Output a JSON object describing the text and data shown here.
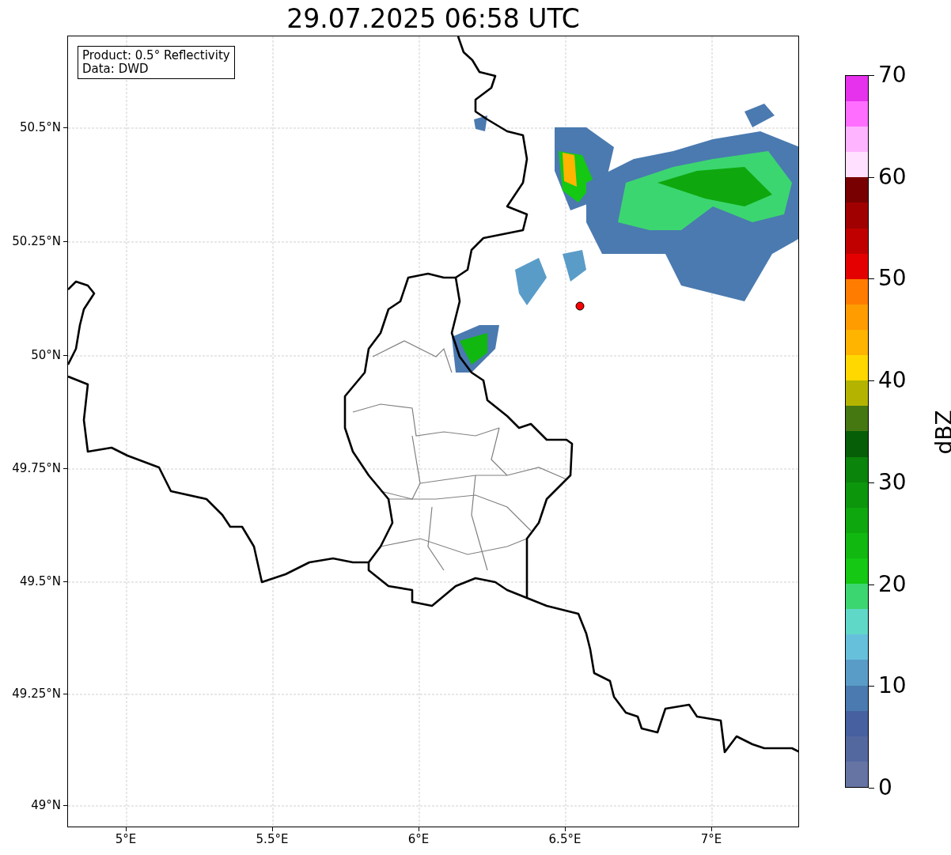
{
  "title": "29.07.2025 06:58 UTC",
  "info_box": {
    "lines": [
      "Product: 0.5° Reflectivity",
      "Data: DWD"
    ]
  },
  "map": {
    "x_ticks": [
      {
        "label": "5°E"
      },
      {
        "label": "5.5°E"
      },
      {
        "label": "6°E"
      },
      {
        "label": "6.5°E"
      },
      {
        "label": "7°E"
      }
    ],
    "y_ticks": [
      {
        "label": "50.5°N"
      },
      {
        "label": "50.25°N"
      },
      {
        "label": "50°N"
      },
      {
        "label": "49.75°N"
      },
      {
        "label": "49.5°N"
      },
      {
        "label": "49.25°N"
      },
      {
        "label": "49°N"
      }
    ]
  },
  "colorbar": {
    "label": "dBZ",
    "ticks": [
      {
        "label": "70"
      },
      {
        "label": "60"
      },
      {
        "label": "50"
      },
      {
        "label": "40"
      },
      {
        "label": "30"
      },
      {
        "label": "20"
      },
      {
        "label": "10"
      },
      {
        "label": "0"
      }
    ],
    "bands": [
      {
        "color": "#6674a4"
      },
      {
        "color": "#5468a0"
      },
      {
        "color": "#4660a0"
      },
      {
        "color": "#4a7ab0"
      },
      {
        "color": "#5a9cc8"
      },
      {
        "color": "#66c0dc"
      },
      {
        "color": "#60d8c8"
      },
      {
        "color": "#3cd670"
      },
      {
        "color": "#14c814"
      },
      {
        "color": "#10b810"
      },
      {
        "color": "#0ea80e"
      },
      {
        "color": "#0c960c"
      },
      {
        "color": "#0a840a"
      },
      {
        "color": "#065e06"
      },
      {
        "color": "#467812"
      },
      {
        "color": "#b4b400"
      },
      {
        "color": "#ffd800"
      },
      {
        "color": "#ffb400"
      },
      {
        "color": "#ff9c00"
      },
      {
        "color": "#ff7c00"
      },
      {
        "color": "#e40000"
      },
      {
        "color": "#c00000"
      },
      {
        "color": "#a00000"
      },
      {
        "color": "#780000"
      },
      {
        "color": "#ffe0ff"
      },
      {
        "color": "#ffb4ff"
      },
      {
        "color": "#ff6eff"
      },
      {
        "color": "#e632ec"
      }
    ]
  }
}
